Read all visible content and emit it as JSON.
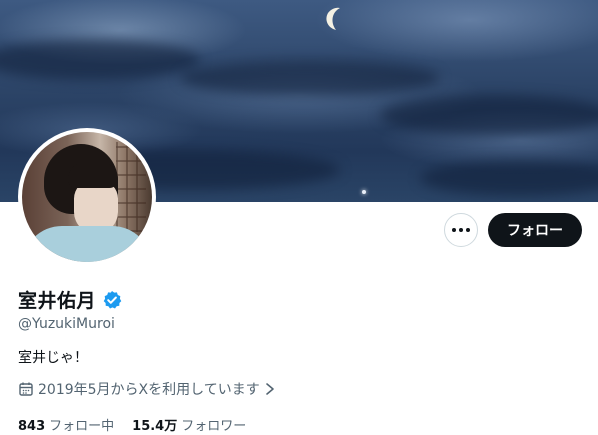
{
  "profile": {
    "display_name": "室井佑月",
    "handle": "@YuzukiMuroi",
    "bio": "室井じゃ！",
    "joined": "2019年5月からXを利用しています",
    "verified": true,
    "accent_color": "#1d9bf0"
  },
  "actions": {
    "more_icon": "ellipsis-icon",
    "follow_label": "フォロー"
  },
  "stats": {
    "following_count": "843",
    "following_label": "フォロー中",
    "followers_count": "15.4万",
    "followers_label": "フォロワー"
  },
  "icons": {
    "verified": "verified-badge-icon",
    "joined": "calendar-icon",
    "joined_more": "chevron-right-icon"
  }
}
